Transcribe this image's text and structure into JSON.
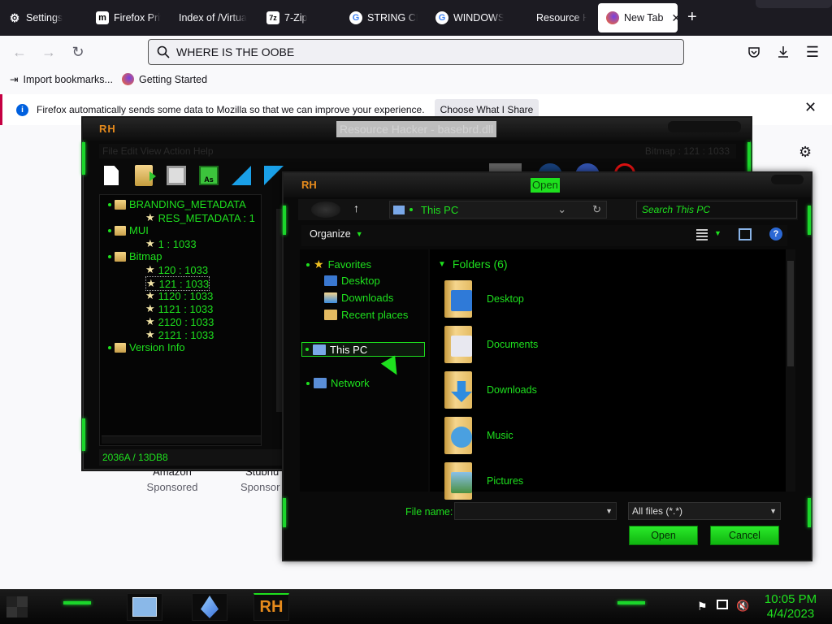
{
  "browser": {
    "tabs": [
      {
        "label": "Settings",
        "icon": "gear-icon"
      },
      {
        "label": "Firefox Priv",
        "icon": "m-logo-icon"
      },
      {
        "label": "Index of /Virtua",
        "icon": "none"
      },
      {
        "label": "7-Zip",
        "icon": "7zip-icon"
      },
      {
        "label": "STRING CH",
        "icon": "google-icon"
      },
      {
        "label": "WINDOWS L",
        "icon": "google-icon"
      },
      {
        "label": "Resource H",
        "icon": "none"
      },
      {
        "label": "New Tab",
        "icon": "firefox-icon"
      }
    ],
    "new_tab_plus": "+",
    "url": "WHERE IS THE OOBE",
    "bookmarks": [
      {
        "label": "Import bookmarks..."
      },
      {
        "label": "Getting Started"
      }
    ],
    "infobar_text": "Firefox automatically sends some data to Mozilla so that we can improve your experience.",
    "infobar_button": "Choose What I Share",
    "sponsored": [
      {
        "name": "Amazon",
        "tag": "Sponsored"
      },
      {
        "name": "Stubhu",
        "tag": "Sponsor"
      }
    ]
  },
  "resource_hacker": {
    "logo": "RH",
    "title": "Resource Hacker - basebrd.dll",
    "menu_text": "File  Edit  View  Action  Help",
    "menu_right": "Bitmap : 121 : 1033",
    "tree": [
      {
        "label": "BRANDING_METADATA",
        "level": 0,
        "type": "folder"
      },
      {
        "label": "RES_METADATA : 1",
        "level": 1,
        "type": "star"
      },
      {
        "label": "MUI",
        "level": 0,
        "type": "folder"
      },
      {
        "label": "1 : 1033",
        "level": 1,
        "type": "star"
      },
      {
        "label": "Bitmap",
        "level": 0,
        "type": "folder"
      },
      {
        "label": "120 : 1033",
        "level": 1,
        "type": "star"
      },
      {
        "label": "121 : 1033",
        "level": 1,
        "type": "star"
      },
      {
        "label": "1120 : 1033",
        "level": 1,
        "type": "star"
      },
      {
        "label": "1121 : 1033",
        "level": 1,
        "type": "star"
      },
      {
        "label": "2120 : 1033",
        "level": 1,
        "type": "star"
      },
      {
        "label": "2121 : 1033",
        "level": 1,
        "type": "star"
      },
      {
        "label": "Version Info",
        "level": 0,
        "type": "folder"
      }
    ],
    "status": "2036A / 13DB8"
  },
  "open_dialog": {
    "logo": "RH",
    "title": "Open",
    "address": "This PC",
    "search_placeholder": "Search This PC",
    "organize": "Organize",
    "nav": {
      "favorites": "Favorites",
      "favorites_items": [
        "Desktop",
        "Downloads",
        "Recent places"
      ],
      "this_pc": "This PC",
      "network": "Network"
    },
    "folders_header": "Folders (6)",
    "folders": [
      "Desktop",
      "Documents",
      "Downloads",
      "Music",
      "Pictures"
    ],
    "file_name_label": "File name:",
    "file_name_value": "",
    "file_type": "All files (*.*)",
    "open_button": "Open",
    "cancel_button": "Cancel"
  },
  "taskbar": {
    "time": "10:05 PM",
    "date": "4/4/2023",
    "pinned": [
      "control-panel-icon",
      "crystal-icon",
      "resource-hacker-icon"
    ],
    "rh_label": "RH"
  },
  "colors": {
    "accent_green": "#1ee01e",
    "rh_orange": "#e58a1c",
    "firefox_dark": "#1c1b22"
  }
}
